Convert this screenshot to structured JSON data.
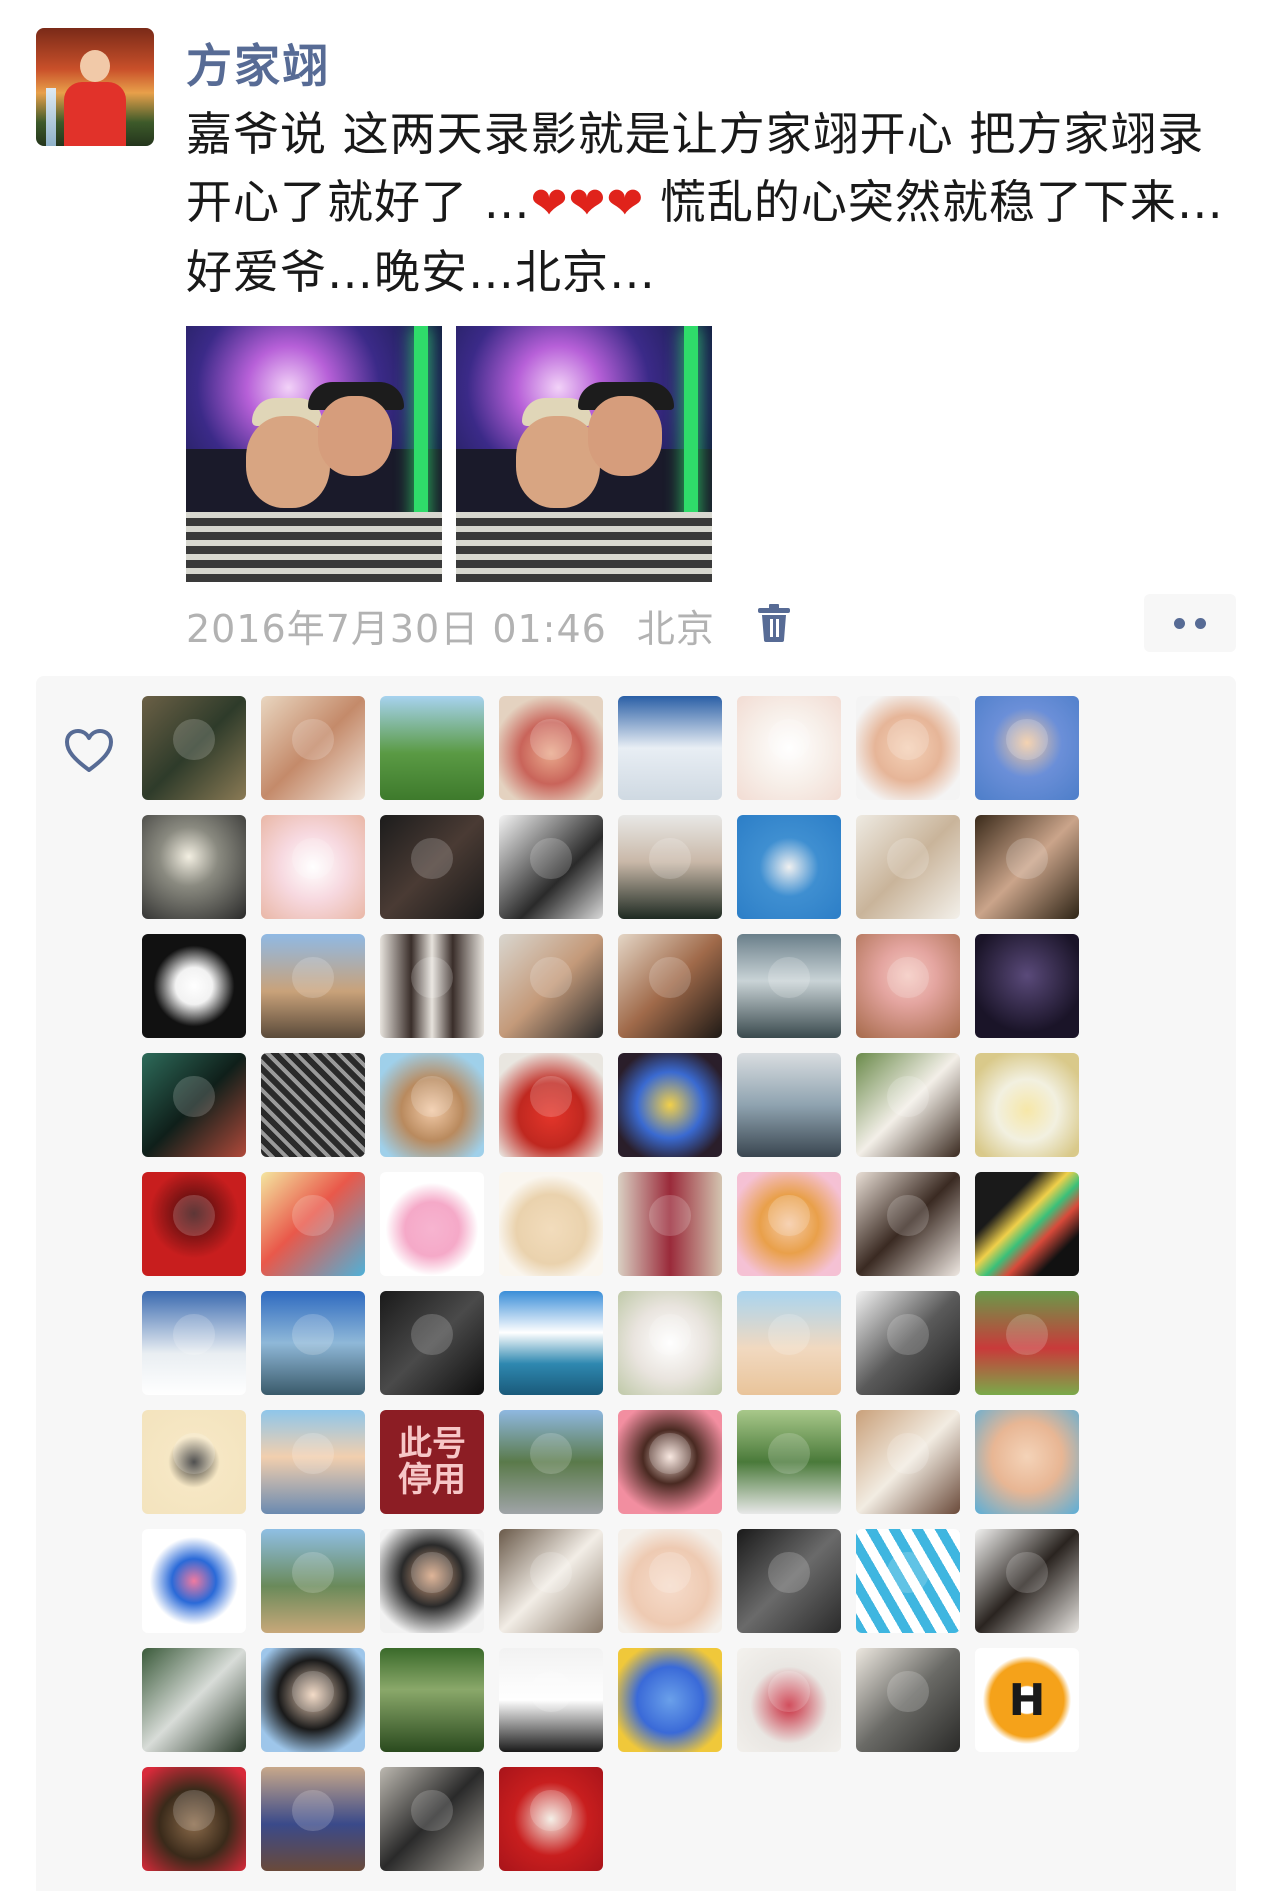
{
  "post": {
    "author": "方家翊",
    "text_part1": "嘉爷说 这两天录影就是让方家翊开心 把方家翊录开心了就好了 …",
    "hearts": "❤❤❤",
    "text_part2": " 慌乱的心突然就稳了下来… 好爱爷…晚安…北京…",
    "timestamp": "2016年7月30日 01:46",
    "location": "北京",
    "photo_count": 2
  },
  "icons": {
    "trash": "trash-icon",
    "more": "more-dots-icon",
    "like": "heart-outline-icon"
  },
  "colors": {
    "author": "#576b95",
    "meta": "#b2b2b2",
    "panel": "#f7f7f7"
  },
  "likes": {
    "count": 76,
    "disabled_account_label_line1": "此号",
    "disabled_account_label_line2": "停用"
  }
}
